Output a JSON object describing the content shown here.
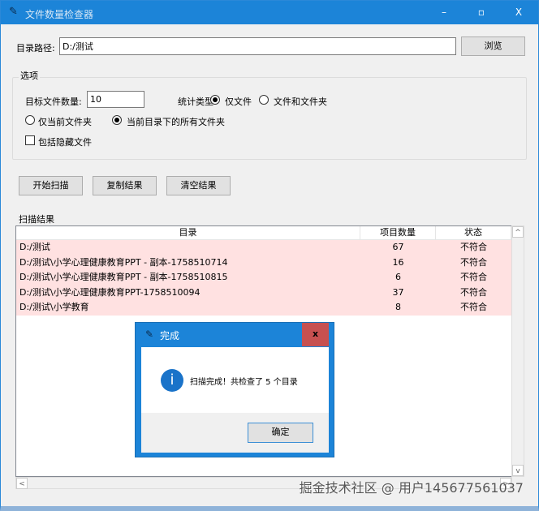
{
  "window": {
    "title": "文件数量检查器",
    "minimize": "–",
    "maximize": "▫",
    "close": "X"
  },
  "path": {
    "label": "目录路径:",
    "value": "D:/测试",
    "browse": "浏览"
  },
  "options": {
    "group_label": "选项",
    "target_label": "目标文件数量:",
    "target_value": "10",
    "type_label": "统计类型:",
    "type_files_only": "仅文件",
    "type_files_and_folders": "文件和文件夹",
    "scope_current": "仅当前文件夹",
    "scope_all": "当前目录下的所有文件夹",
    "include_hidden": "包括隐藏文件"
  },
  "actions": {
    "start": "开始扫描",
    "copy": "复制结果",
    "clear": "清空结果"
  },
  "results": {
    "group_label": "扫描结果",
    "columns": [
      "目录",
      "项目数量",
      "状态"
    ],
    "rows": [
      {
        "dir": "D:/测试",
        "count": "67",
        "status": "不符合"
      },
      {
        "dir": "D:/测试\\小学心理健康教育PPT - 副本-1758510714",
        "count": "16",
        "status": "不符合"
      },
      {
        "dir": "D:/测试\\小学心理健康教育PPT - 副本-1758510815",
        "count": "6",
        "status": "不符合"
      },
      {
        "dir": "D:/测试\\小学心理健康教育PPT-1758510094",
        "count": "37",
        "status": "不符合"
      },
      {
        "dir": "D:/测试\\小学教育",
        "count": "8",
        "status": "不符合"
      }
    ]
  },
  "dialog": {
    "title": "完成",
    "close": "x",
    "message": "扫描完成！共检查了 5 个目录",
    "ok": "确定",
    "icon": "i"
  },
  "watermark": "掘金技术社区 @ 用户145677561037"
}
